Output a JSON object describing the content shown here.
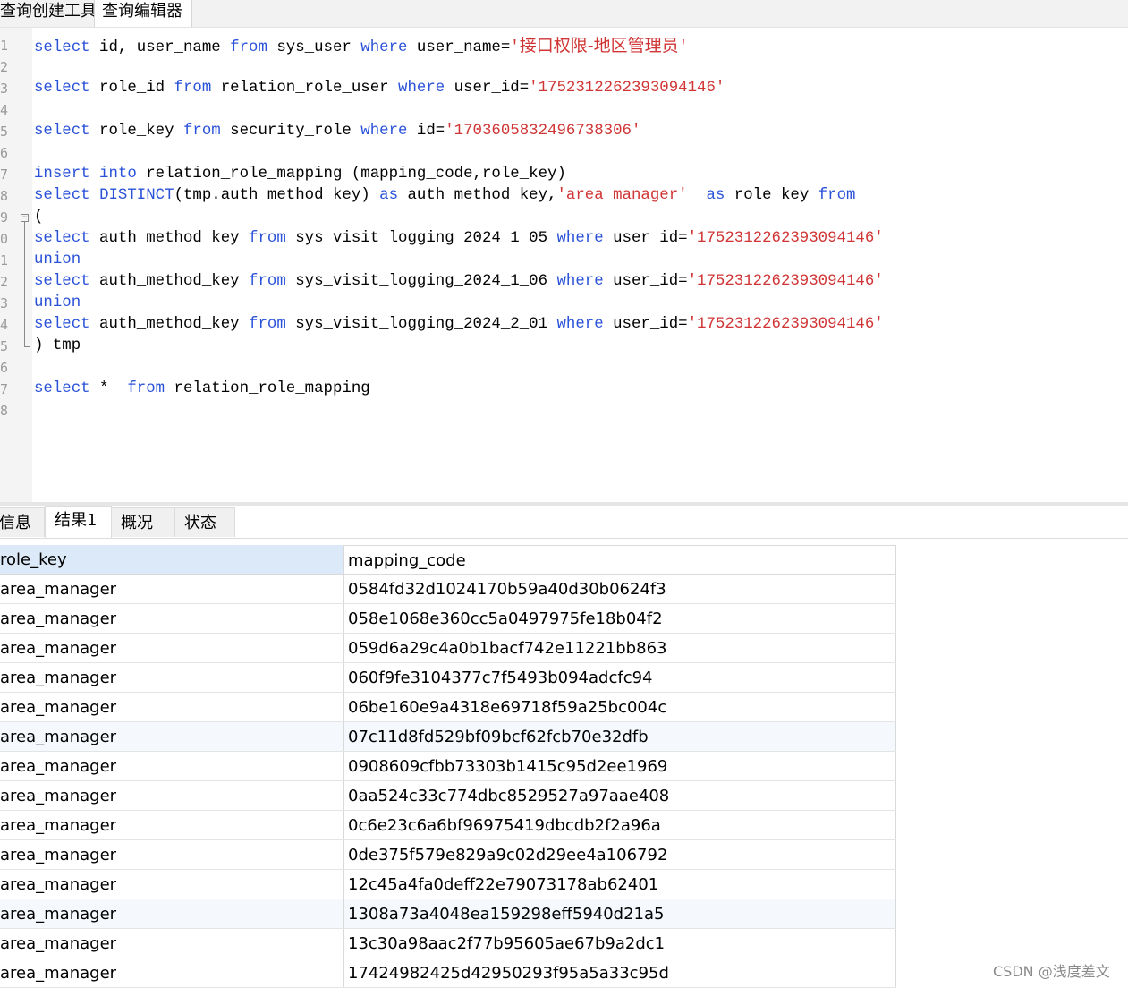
{
  "top_tabs": {
    "query_builder": "查询创建工具",
    "query_editor": "查询编辑器"
  },
  "editor": {
    "lines": [
      {
        "n": "1",
        "segs": [
          [
            "kw",
            "select"
          ],
          [
            "t",
            " id, user_name "
          ],
          [
            "kw",
            "from"
          ],
          [
            "t",
            " sys_user "
          ],
          [
            "kw",
            "where"
          ],
          [
            "t",
            " user_name="
          ],
          [
            "str",
            "'"
          ],
          [
            "zh",
            "接口权限-地区管理员"
          ],
          [
            "str",
            "'"
          ]
        ]
      },
      {
        "n": "2",
        "segs": []
      },
      {
        "n": "3",
        "segs": [
          [
            "kw",
            "select"
          ],
          [
            "t",
            " role_id "
          ],
          [
            "kw",
            "from"
          ],
          [
            "t",
            " relation_role_user "
          ],
          [
            "kw",
            "where"
          ],
          [
            "t",
            " user_id="
          ],
          [
            "str",
            "'1752312262393094146'"
          ]
        ]
      },
      {
        "n": "4",
        "segs": []
      },
      {
        "n": "5",
        "segs": [
          [
            "kw",
            "select"
          ],
          [
            "t",
            " role_key "
          ],
          [
            "kw",
            "from"
          ],
          [
            "t",
            " security_role "
          ],
          [
            "kw",
            "where"
          ],
          [
            "t",
            " id="
          ],
          [
            "str",
            "'1703605832496738306'"
          ]
        ]
      },
      {
        "n": "6",
        "segs": []
      },
      {
        "n": "7",
        "segs": [
          [
            "kw",
            "insert into"
          ],
          [
            "t",
            " relation_role_mapping (mapping_code,role_key)"
          ]
        ]
      },
      {
        "n": "8",
        "segs": [
          [
            "kw",
            "select"
          ],
          [
            "t",
            " "
          ],
          [
            "kw",
            "DISTINCT"
          ],
          [
            "t",
            "(tmp.auth_method_key) "
          ],
          [
            "kw",
            "as"
          ],
          [
            "t",
            " auth_method_key,"
          ],
          [
            "str",
            "'area_manager'"
          ],
          [
            "t",
            "  "
          ],
          [
            "kw",
            "as"
          ],
          [
            "t",
            " role_key "
          ],
          [
            "kw",
            "from"
          ]
        ]
      },
      {
        "n": "9",
        "segs": [
          [
            "t",
            "("
          ]
        ]
      },
      {
        "n": "0",
        "segs": [
          [
            "kw",
            "select"
          ],
          [
            "t",
            " auth_method_key "
          ],
          [
            "kw",
            "from"
          ],
          [
            "t",
            " sys_visit_logging_2024_1_05 "
          ],
          [
            "kw",
            "where"
          ],
          [
            "t",
            " user_id="
          ],
          [
            "str",
            "'1752312262393094146'"
          ]
        ]
      },
      {
        "n": "1",
        "segs": [
          [
            "kw",
            "union"
          ]
        ]
      },
      {
        "n": "2",
        "segs": [
          [
            "kw",
            "select"
          ],
          [
            "t",
            " auth_method_key "
          ],
          [
            "kw",
            "from"
          ],
          [
            "t",
            " sys_visit_logging_2024_1_06 "
          ],
          [
            "kw",
            "where"
          ],
          [
            "t",
            " user_id="
          ],
          [
            "str",
            "'1752312262393094146'"
          ]
        ]
      },
      {
        "n": "3",
        "segs": [
          [
            "kw",
            "union"
          ]
        ]
      },
      {
        "n": "4",
        "segs": [
          [
            "kw",
            "select"
          ],
          [
            "t",
            " auth_method_key "
          ],
          [
            "kw",
            "from"
          ],
          [
            "t",
            " sys_visit_logging_2024_2_01 "
          ],
          [
            "kw",
            "where"
          ],
          [
            "t",
            " user_id="
          ],
          [
            "str",
            "'1752312262393094146'"
          ]
        ]
      },
      {
        "n": "5",
        "segs": [
          [
            "t",
            ") tmp"
          ]
        ]
      },
      {
        "n": "6",
        "segs": []
      },
      {
        "n": "7",
        "segs": [
          [
            "kw",
            "select"
          ],
          [
            "t",
            " *  "
          ],
          [
            "kw",
            "from"
          ],
          [
            "t",
            " relation_role_mapping"
          ]
        ]
      },
      {
        "n": "8",
        "segs": []
      }
    ],
    "fold_marker": "−"
  },
  "result_tabs": {
    "info": "信息",
    "result1": "结果1",
    "overview": "概况",
    "status": "状态"
  },
  "grid": {
    "columns": [
      "role_key",
      "mapping_code"
    ],
    "rows": [
      [
        "area_manager",
        "0584fd32d1024170b59a40d30b0624f3"
      ],
      [
        "area_manager",
        "058e1068e360cc5a0497975fe18b04f2"
      ],
      [
        "area_manager",
        "059d6a29c4a0b1bacf742e11221bb863"
      ],
      [
        "area_manager",
        "060f9fe3104377c7f5493b094adcfc94"
      ],
      [
        "area_manager",
        "06be160e9a4318e69718f59a25bc004c"
      ],
      [
        "area_manager",
        "07c11d8fd529bf09bcf62fcb70e32dfb"
      ],
      [
        "area_manager",
        "0908609cfbb73303b1415c95d2ee1969"
      ],
      [
        "area_manager",
        "0aa524c33c774dbc8529527a97aae408"
      ],
      [
        "area_manager",
        "0c6e23c6a6bf96975419dbcdb2f2a96a"
      ],
      [
        "area_manager",
        "0de375f579e829a9c02d29ee4a106792"
      ],
      [
        "area_manager",
        "12c45a4fa0deff22e79073178ab62401"
      ],
      [
        "area_manager",
        "1308a73a4048ea159298eff5940d21a5"
      ],
      [
        "area_manager",
        "13c30a98aac2f77b95605ae67b9a2dc1"
      ],
      [
        "area_manager",
        "17424982425d42950293f95a5a33c95d"
      ]
    ]
  },
  "watermark": "CSDN @浅度差文"
}
